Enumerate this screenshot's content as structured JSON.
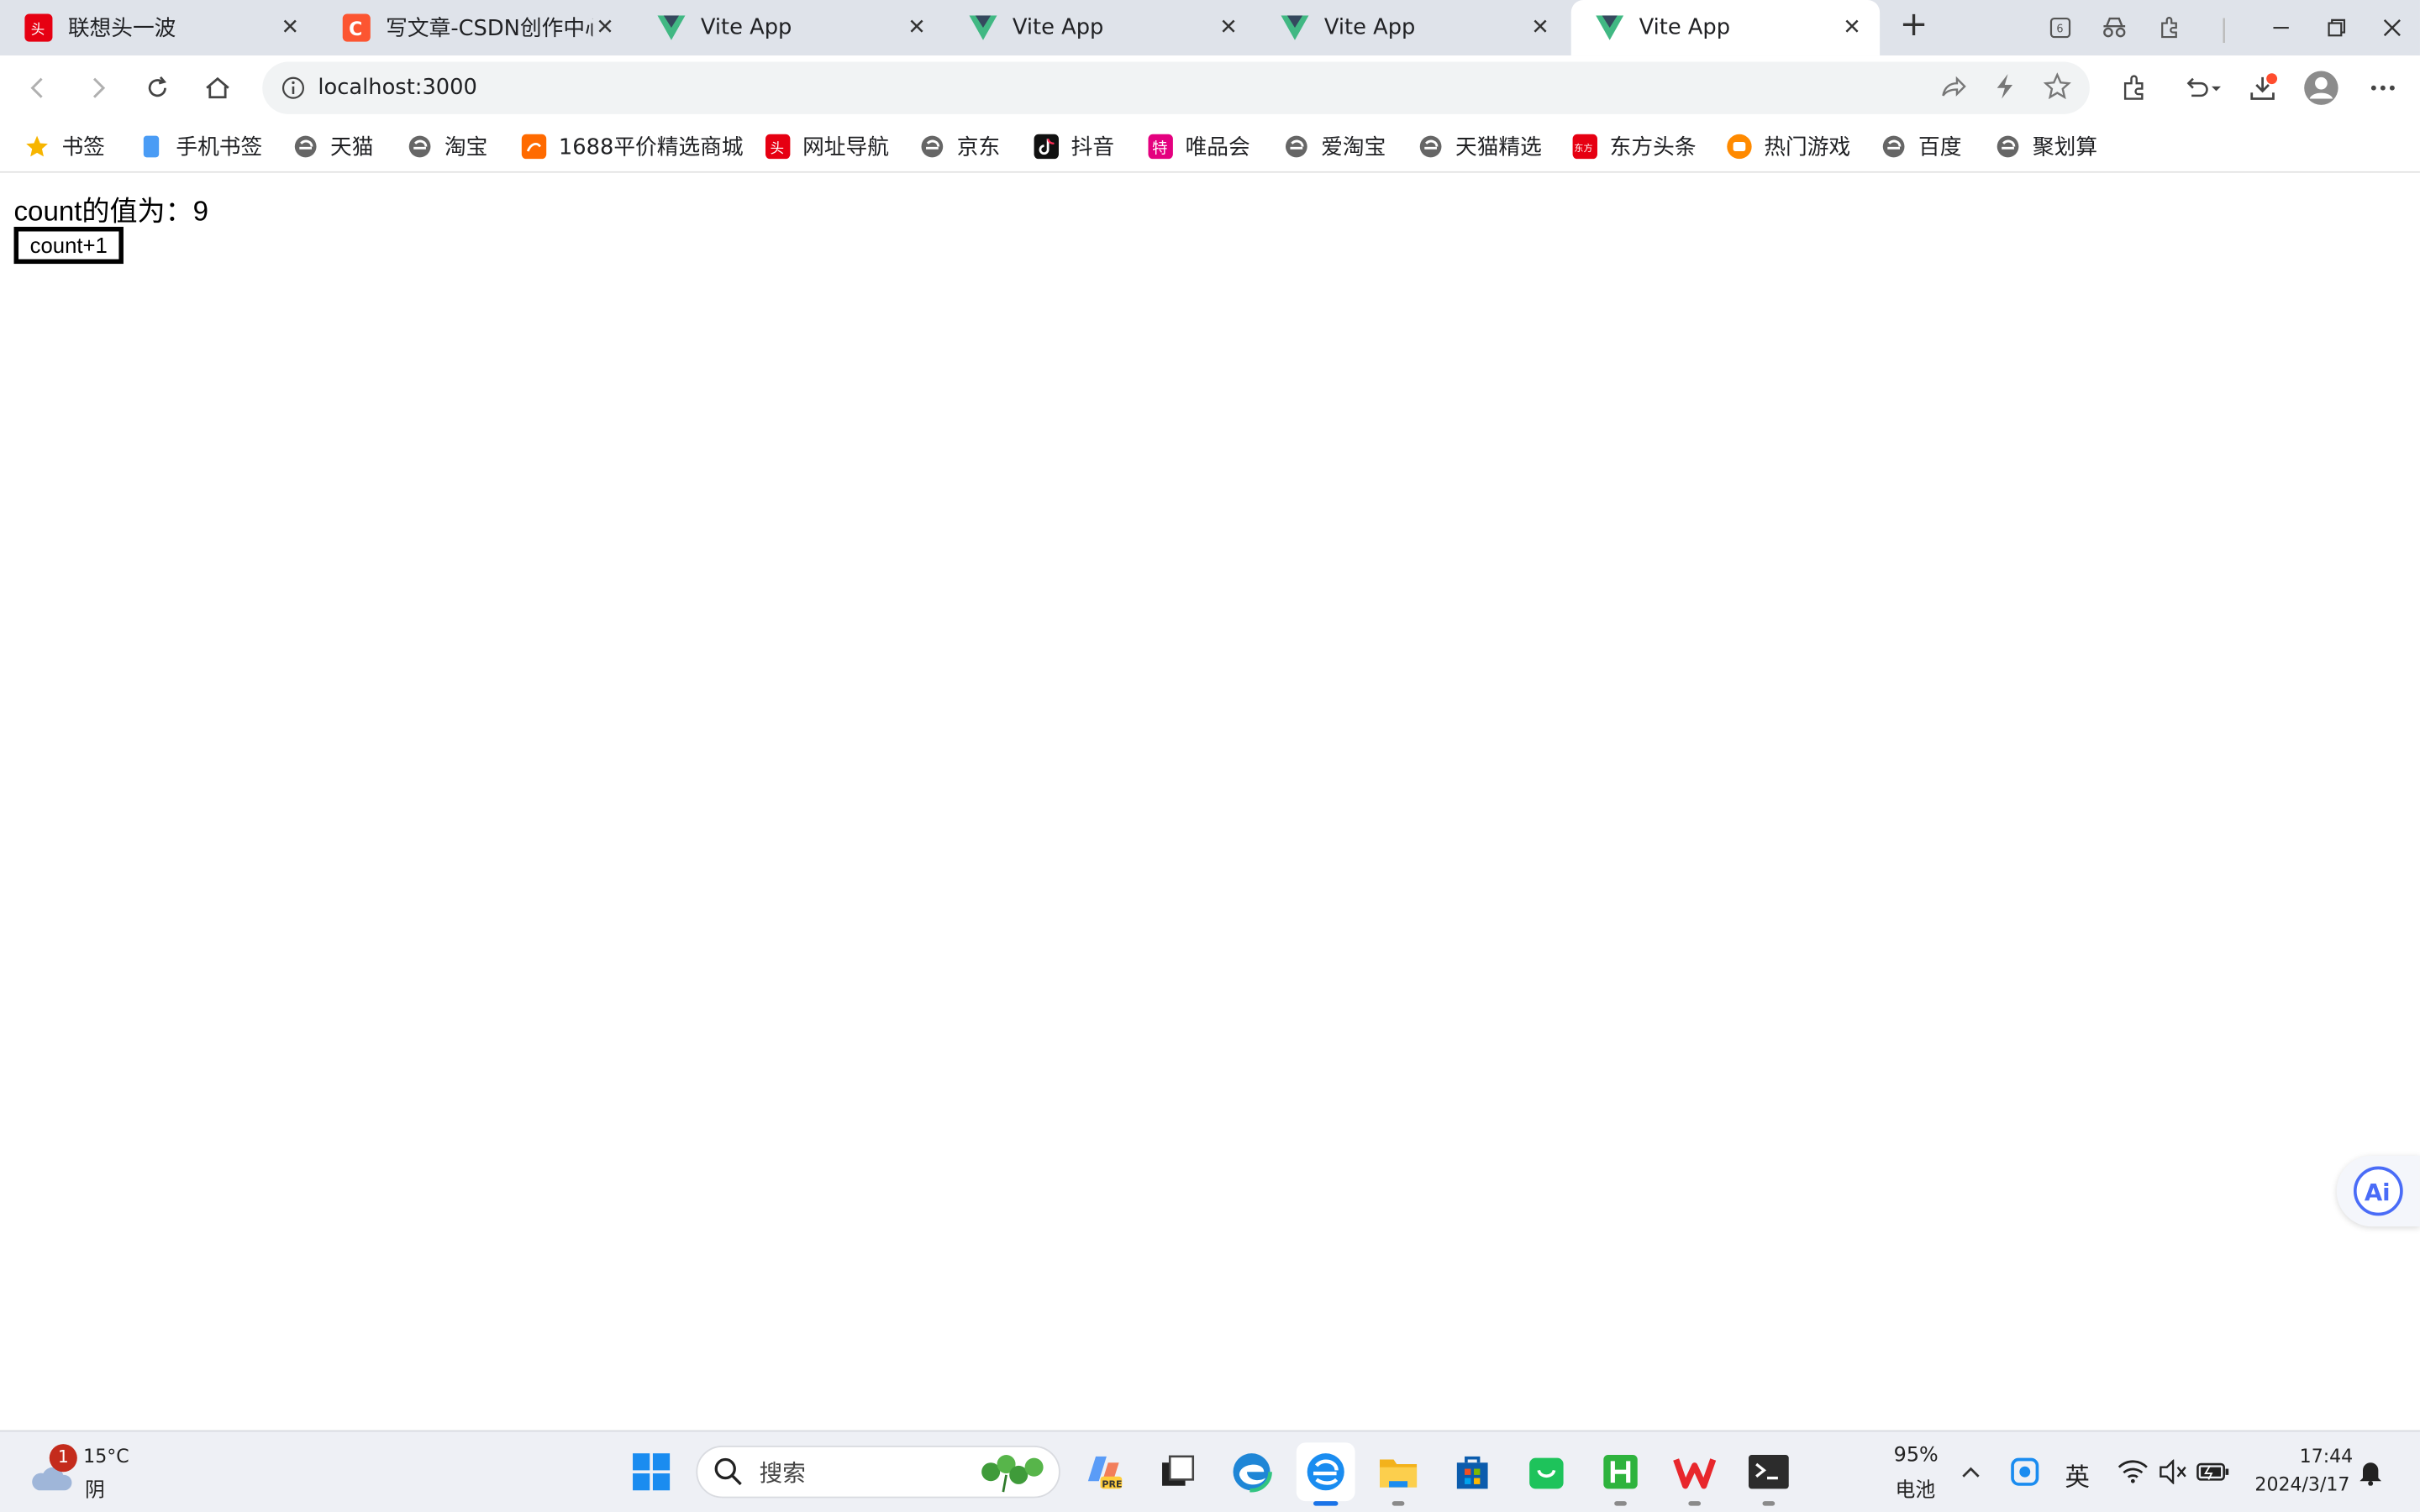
{
  "tabs": [
    {
      "title": "联想头一波",
      "icon": "lenovo-icon"
    },
    {
      "title": "写文章-CSDN创作中心",
      "icon": "csdn-icon"
    },
    {
      "title": "Vite App",
      "icon": "vue-icon"
    },
    {
      "title": "Vite App",
      "icon": "vue-icon"
    },
    {
      "title": "Vite App",
      "icon": "vue-icon"
    },
    {
      "title": "Vite App",
      "icon": "vue-icon",
      "active": true
    }
  ],
  "toolbar": {
    "url": "localhost:3000"
  },
  "bookmarks": [
    {
      "label": "书签"
    },
    {
      "label": "手机书签"
    },
    {
      "label": "天猫"
    },
    {
      "label": "淘宝"
    },
    {
      "label": "1688平价精选商城"
    },
    {
      "label": "网址导航"
    },
    {
      "label": "京东"
    },
    {
      "label": "抖音"
    },
    {
      "label": "唯品会"
    },
    {
      "label": "爱淘宝"
    },
    {
      "label": "天猫精选"
    },
    {
      "label": "东方头条"
    },
    {
      "label": "热门游戏"
    },
    {
      "label": "百度"
    },
    {
      "label": "聚划算"
    }
  ],
  "page": {
    "count_text": "count的值为：9",
    "button_label": "count+1"
  },
  "taskbar": {
    "weather_temp": "15°C",
    "weather_desc": "阴",
    "weather_badge": "1",
    "search_placeholder": "搜索",
    "battery_percent": "95%",
    "battery_label": "电池",
    "ime": "英",
    "time": "17:44",
    "date": "2024/3/17"
  },
  "colors": {
    "tab_strip": "#dfe3ea",
    "vue_green": "#41b883",
    "vue_dark": "#35495e",
    "csdn_orange": "#fc5531",
    "taskbar_bg": "#eef0f5"
  }
}
